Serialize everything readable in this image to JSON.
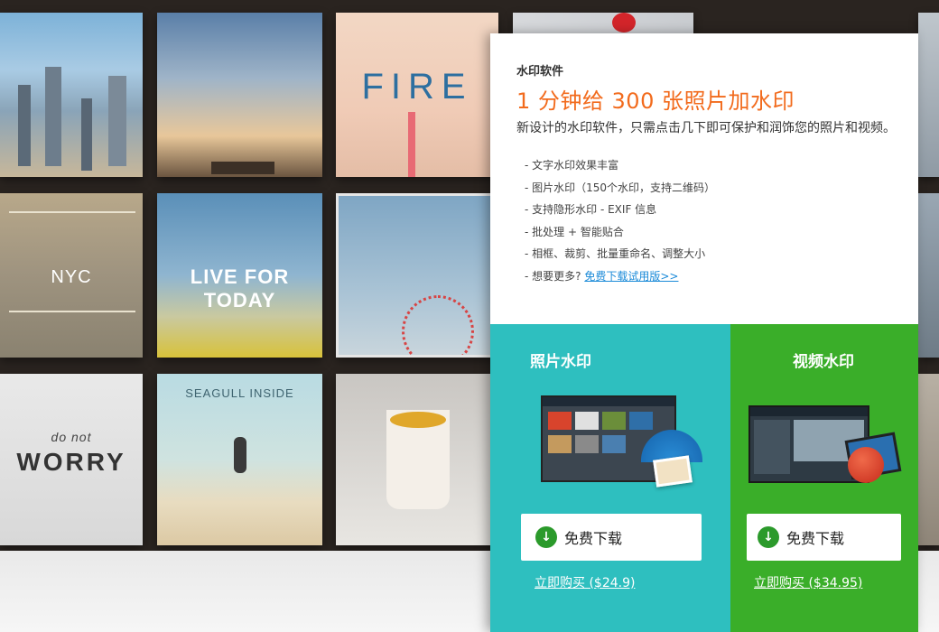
{
  "panel": {
    "brand": "水印软件",
    "headline": "1 分钟给 300 张照片加水印",
    "intro": "新设计的水印软件，只需点击几下即可保护和润饰您的照片和视频。",
    "features": [
      "- 文字水印效果丰富",
      "- 图片水印（150个水印，支持二维码）",
      "- 支持隐形水印 - EXIF 信息",
      "- 批处理 + 智能贴合",
      "- 相框、裁剪、批量重命名、调整大小"
    ],
    "more_prefix": "- 想要更多?",
    "more_link": "免费下载试用版>>"
  },
  "photo": {
    "title": "照片水印",
    "download_label": "免费下载",
    "buy_label": "立即购买 ($24.9)"
  },
  "video": {
    "title": "视频水印",
    "download_label": "免费下载",
    "buy_label": "立即购买 ($34.95)"
  },
  "tiles": {
    "fire": "FIRE",
    "nyc": "NYC",
    "live_for_today": "LIVE FOR TODAY",
    "seagull": "SEAGULL INSIDE",
    "worry": "WORRY",
    "do_not": "do not"
  },
  "colors": {
    "accent_orange": "#f26b1d",
    "photo_teal": "#2ebfbf",
    "video_green": "#3aae29",
    "link_blue": "#1a8ad8"
  }
}
